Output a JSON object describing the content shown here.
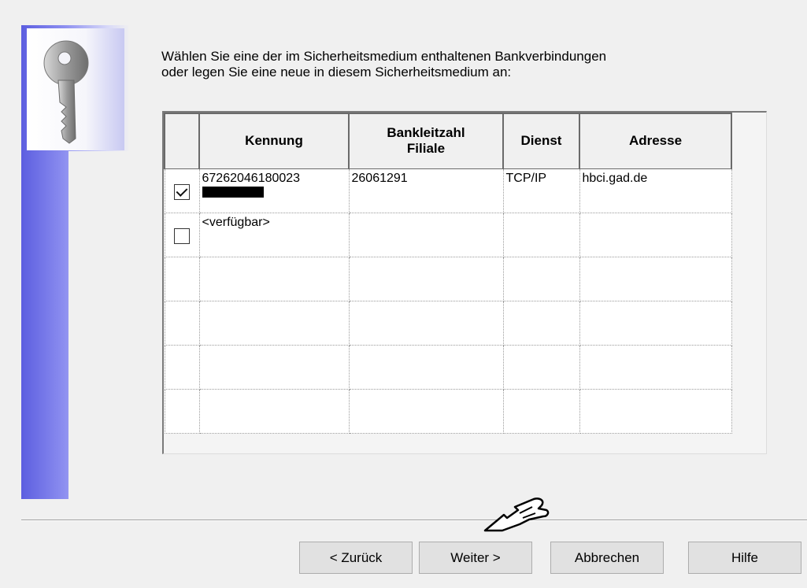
{
  "intro": {
    "text": "Wählen Sie eine der im Sicherheitsmedium enthaltenen Bankverbindungen\noder legen Sie eine neue in diesem Sicherheitsmedium an:"
  },
  "table": {
    "columns": [
      "Kennung",
      "Bankleitzahl\nFiliale",
      "Dienst",
      "Adresse"
    ],
    "rows": [
      {
        "checked": true,
        "kennung": "67262046180023",
        "blz": "26061291",
        "dienst": "TCP/IP",
        "adresse": "hbci.gad.de"
      },
      {
        "checked": false,
        "kennung": "<verfügbar>",
        "blz": "",
        "dienst": "",
        "adresse": ""
      }
    ]
  },
  "buttons": {
    "back": "< Zurück",
    "next": "Weiter >",
    "cancel": "Abbrechen",
    "help": "Hilfe"
  },
  "icons": {
    "sidebar": "key-icon",
    "pointer": "hand-cursor-icon"
  }
}
